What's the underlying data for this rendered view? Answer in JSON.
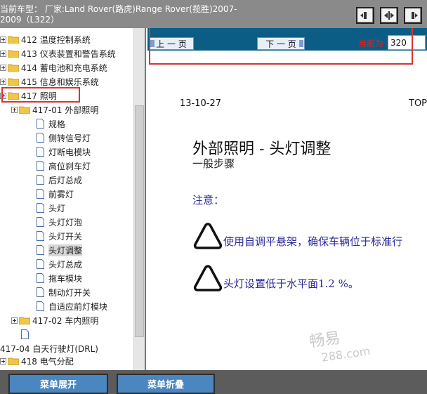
{
  "header": {
    "vehicle_line1": "当前车型： 厂家:Land Rover(路虎)Range Rover(揽胜)2007-",
    "vehicle_line2": "2009（L322）"
  },
  "tree": {
    "items": [
      {
        "label": "412 温度控制系统"
      },
      {
        "label": "413 仪表装置和警告系统"
      },
      {
        "label": "414 蓄电池和充电系统"
      },
      {
        "label": "415 信息和娱乐系统"
      },
      {
        "label": "417 照明"
      },
      {
        "label": "417-01 外部照明"
      },
      {
        "label": "规格"
      },
      {
        "label": "侧转信号灯"
      },
      {
        "label": "灯断电模块"
      },
      {
        "label": "高位刹车灯"
      },
      {
        "label": "后灯总成"
      },
      {
        "label": "前雾灯"
      },
      {
        "label": "头灯"
      },
      {
        "label": "头灯灯泡"
      },
      {
        "label": "头灯开关"
      },
      {
        "label": "头灯调整"
      },
      {
        "label": "头灯总成"
      },
      {
        "label": "拖车模块"
      },
      {
        "label": "制动灯开关"
      },
      {
        "label": "自适应前灯模块"
      },
      {
        "label": "417-02 车内照明"
      },
      {
        "label": ""
      },
      {
        "label": "417-04 白天行驶灯(DRL)"
      },
      {
        "label": "418 电气分配"
      }
    ]
  },
  "nav": {
    "prev_label": "上 一 页",
    "next_label": "下 一 页",
    "current_label": "当前为",
    "current_page": "320"
  },
  "document": {
    "date": "13-10-27",
    "top_cut": "TOP",
    "title": "外部照明 - 头灯调整",
    "subtitle": "一般步骤",
    "note_label": "注意：",
    "warning1": "使用自调平悬架，确保车辆位于标准行",
    "warning2": "头灯设置低于水平面1.2 %。"
  },
  "watermark": {
    "line1": "畅易",
    "line2": "288.com"
  },
  "footer": {
    "expand_label": "菜单展开",
    "collapse_label": "菜单折叠"
  },
  "colors": {
    "header_bg": "#8a8a8a",
    "navbar_bg": "#0b5d85",
    "highlight_box": "#e03030",
    "footer_button": "#4a86c0"
  }
}
